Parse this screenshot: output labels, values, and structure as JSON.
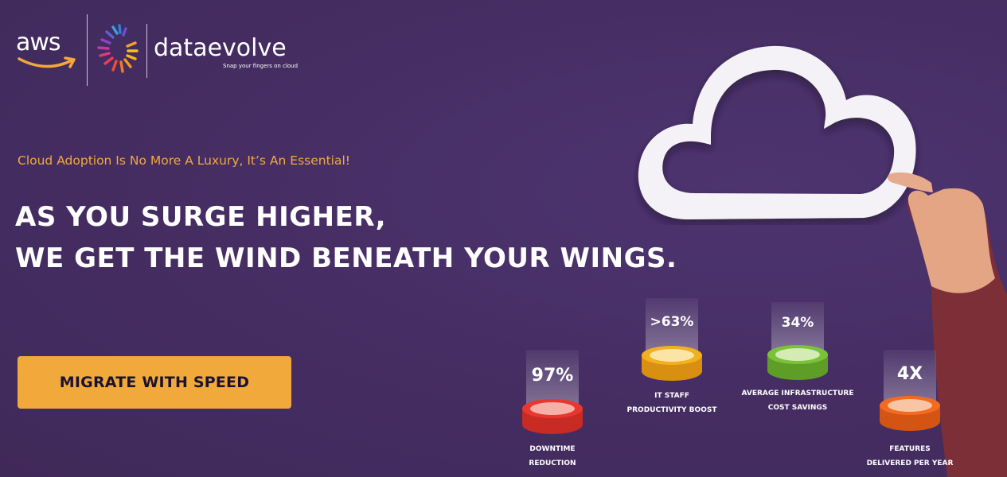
{
  "logos": {
    "aws": "aws",
    "brand_name": "dataevolve",
    "brand_tagline": "Snap your fingers on cloud"
  },
  "tagline": "Cloud Adoption Is No More A Luxury, It’s An Essential!",
  "headline": {
    "line1": "AS YOU SURGE HIGHER,",
    "line2": "WE GET THE WIND BENEATH YOUR WINGS."
  },
  "cta": {
    "label": "MIGRATE WITH SPEED"
  },
  "stats": [
    {
      "value": "97%",
      "label_line1": "DOWNTIME",
      "label_line2": "REDUCTION",
      "color": "#e8372f"
    },
    {
      "value": ">63%",
      "label_line1": "IT STAFF",
      "label_line2": "PRODUCTIVITY BOOST",
      "color": "#f2b01c"
    },
    {
      "value": "34%",
      "label_line1": "AVERAGE INFRASTRUCTURE",
      "label_line2": "COST SAVINGS",
      "color": "#7cc13a"
    },
    {
      "value": "4X",
      "label_line1": "FEATURES",
      "label_line2": "DELIVERED PER YEAR",
      "color": "#f26b21"
    }
  ],
  "colors": {
    "background": "#452d62",
    "accent": "#f2a93b",
    "text": "#ffffff"
  }
}
